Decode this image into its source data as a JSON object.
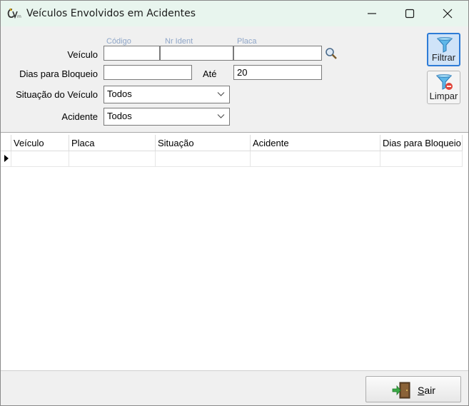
{
  "window": {
    "title": "Veículos Envolvidos em Acidentes"
  },
  "filters": {
    "veiculo": {
      "label": "Veículo",
      "col_codigo": "Código",
      "col_nr_ident": "Nr Ident",
      "col_placa": "Placa",
      "codigo_value": "",
      "nr_ident_value": "",
      "placa_value": ""
    },
    "dias_bloqueio": {
      "label": "Dias para Bloqueio",
      "from_value": "",
      "ate_label": "Até",
      "to_value": "20"
    },
    "situacao": {
      "label": "Situação do Veículo",
      "selected": "Todos"
    },
    "acidente": {
      "label": "Acidente",
      "selected": "Todos"
    }
  },
  "toolbar": {
    "filtrar_label": "Filtrar",
    "limpar_label": "Limpar"
  },
  "grid": {
    "columns": [
      "Veículo",
      "Placa",
      "Situação",
      "Acidente",
      "Dias para Bloqueio"
    ],
    "rows": []
  },
  "footer": {
    "sair_label": "Sair"
  },
  "colors": {
    "titlebar": "#e8f5ee",
    "accent": "#2e7bd6",
    "sublabel": "#8fa6c8"
  }
}
